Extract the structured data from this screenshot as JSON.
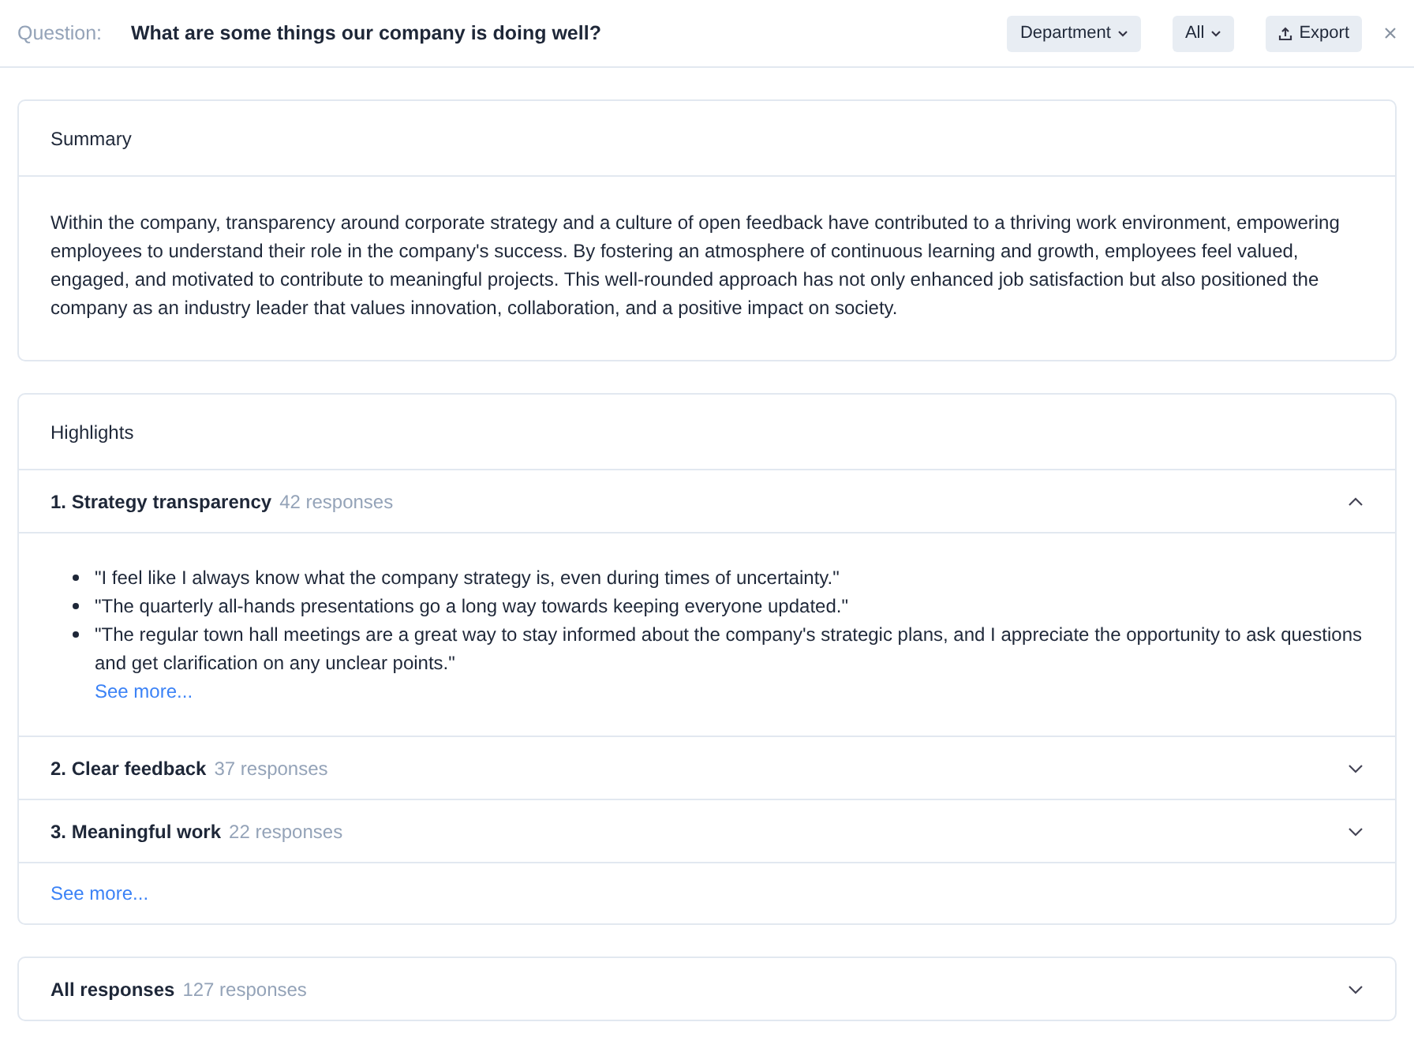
{
  "header": {
    "label": "Question:",
    "question": "What are some things our company is doing well?",
    "filters": [
      "Department",
      "All"
    ],
    "export_button": "Export"
  },
  "summary": {
    "title": "Summary",
    "text": "Within the company, transparency around corporate strategy and a culture of open feedback have contributed to a thriving work environment, empowering employees to understand their role in the company's success. By fostering an atmosphere of continuous learning and growth, employees feel valued, engaged, and motivated to contribute to meaningful projects. This well-rounded approach has not only enhanced job satisfaction but also positioned the company as an industry leader that values innovation, collaboration, and a positive impact on society."
  },
  "highlights": {
    "title": "Highlights",
    "items": [
      {
        "title": "1. Strategy transparency",
        "count": "42 responses",
        "expanded": true,
        "quotes": [
          "\"I feel like I always know what the company strategy is, even during times of uncertainty.\"",
          "\"The quarterly all-hands presentations go a long way towards keeping everyone updated.\"",
          "\"The regular town hall meetings are a great way to stay informed about the company's strategic plans, and I appreciate the opportunity to ask questions and get clarification on any unclear points.\""
        ],
        "see_more": "See more..."
      },
      {
        "title": "2. Clear feedback",
        "count": "37 responses",
        "expanded": false
      },
      {
        "title": "3. Meaningful work",
        "count": "22 responses",
        "expanded": false
      }
    ],
    "see_more": "See more..."
  },
  "all_responses": {
    "title": "All responses",
    "count": "127 responses",
    "expanded": false
  }
}
